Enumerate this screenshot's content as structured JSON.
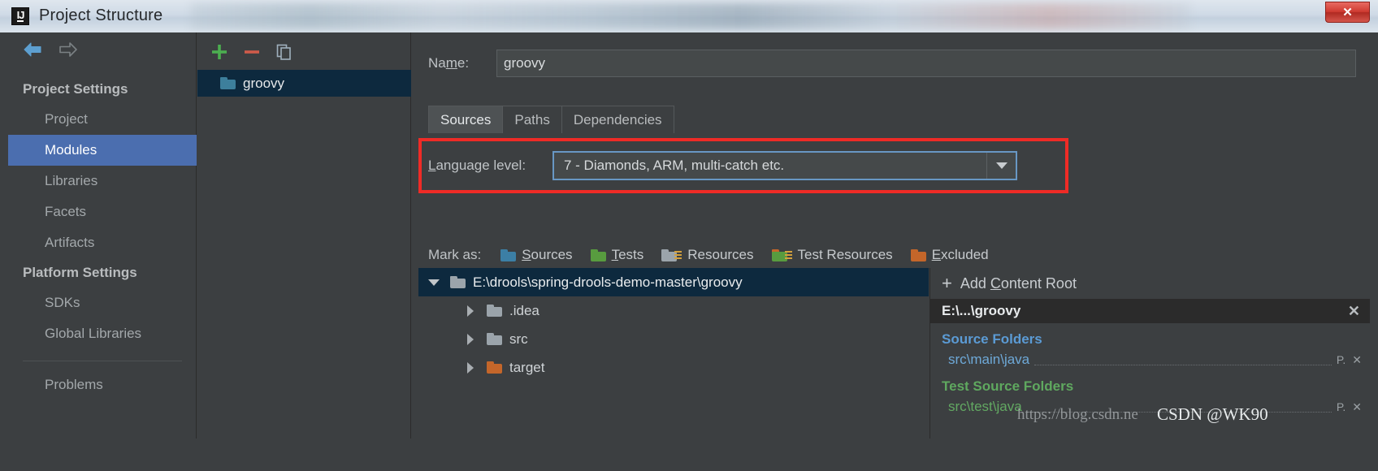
{
  "window": {
    "title": "Project Structure",
    "logo_text": "IJ",
    "close_label": "✕"
  },
  "nav": {
    "back_icon": "back-arrow-icon",
    "forward_icon": "forward-arrow-icon",
    "groups": [
      {
        "label": "Project Settings",
        "items": [
          {
            "label": "Project",
            "selected": false
          },
          {
            "label": "Modules",
            "selected": true
          },
          {
            "label": "Libraries",
            "selected": false
          },
          {
            "label": "Facets",
            "selected": false
          },
          {
            "label": "Artifacts",
            "selected": false
          }
        ]
      },
      {
        "label": "Platform Settings",
        "items": [
          {
            "label": "SDKs",
            "selected": false
          },
          {
            "label": "Global Libraries",
            "selected": false
          }
        ]
      }
    ],
    "problems_label": "Problems"
  },
  "modules": {
    "toolbar": {
      "add_label": "+",
      "remove_label": "−",
      "copy_icon": "copy-icon"
    },
    "items": [
      {
        "label": "groovy",
        "selected": true
      }
    ]
  },
  "detail": {
    "name_label_before": "Na",
    "name_label_mnemonic": "m",
    "name_label_after": "e:",
    "name_value": "groovy",
    "name_placeholder": "",
    "tabs": [
      {
        "label": "Sources",
        "active": true
      },
      {
        "label": "Paths",
        "active": false
      },
      {
        "label": "Dependencies",
        "active": false
      }
    ],
    "language_level": {
      "label_mnemonic": "L",
      "label_after": "anguage level:",
      "value": "7 - Diamonds, ARM, multi-catch etc.",
      "caret_icon": "chevron-down-icon",
      "highlight_color": "#ef2b26",
      "focus_border_color": "#6897c4"
    },
    "mark_as": {
      "label": "Mark as:",
      "options": [
        {
          "mnemonic": "S",
          "rest": "ources",
          "icon": "folder-sources-icon",
          "color": "#3c7fa5"
        },
        {
          "mnemonic": "T",
          "rest": "ests",
          "icon": "folder-tests-icon",
          "color": "#589c3f"
        },
        {
          "mnemonic": "R",
          "rest": "esources",
          "icon": "folder-resources-icon",
          "color": "#9ba4ab"
        },
        {
          "mnemonic": "T",
          "rest": "est Resources",
          "icon": "folder-test-resources-icon",
          "color": "#589c3f"
        },
        {
          "mnemonic": "E",
          "rest": "xcluded",
          "icon": "folder-excluded-icon",
          "color": "#c4662a"
        }
      ]
    },
    "tree": [
      {
        "label": "E:\\drools\\spring-drools-demo-master\\groovy",
        "depth": 0,
        "twisty": "down",
        "folder": "gray",
        "selected": true
      },
      {
        "label": ".idea",
        "depth": 1,
        "twisty": "right",
        "folder": "gray",
        "selected": false
      },
      {
        "label": "src",
        "depth": 1,
        "twisty": "right",
        "folder": "gray",
        "selected": false
      },
      {
        "label": "target",
        "depth": 1,
        "twisty": "right",
        "folder": "orange",
        "selected": false
      }
    ],
    "content_roots": {
      "add_label_before": "Add ",
      "add_label_mnemonic": "C",
      "add_label_after": "ontent Root",
      "plus_icon": "plus-icon",
      "root_title": "E:\\...\\groovy",
      "root_close_icon": "close-icon",
      "sections": [
        {
          "title": "Source Folders",
          "kind": "src",
          "rows": [
            {
              "path": "src\\main\\java",
              "actions": [
                "P.",
                "✕"
              ]
            }
          ]
        },
        {
          "title": "Test Source Folders",
          "kind": "test",
          "rows": [
            {
              "path": "src\\test\\java",
              "actions": [
                "P.",
                "✕"
              ]
            }
          ]
        }
      ]
    }
  },
  "watermarks": {
    "url": "https://blog.csdn.ne",
    "author": "CSDN @WK90"
  }
}
